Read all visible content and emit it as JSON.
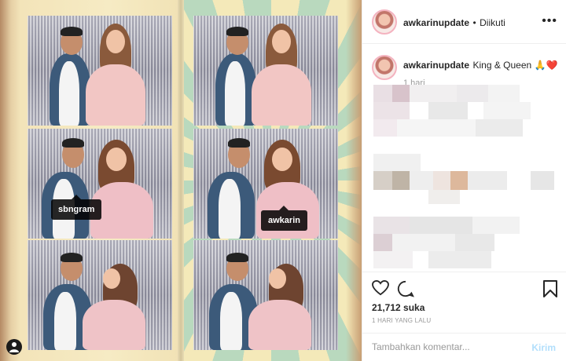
{
  "photo": {
    "tags": [
      "sbngram",
      "awkarin"
    ]
  },
  "header": {
    "username": "awkarinupdate",
    "separator": "•",
    "follow_status": "Diikuti",
    "more_icon": "•••"
  },
  "caption": {
    "username": "awkarinupdate",
    "text": "King & Queen 🙏❤️",
    "age": "1 hari"
  },
  "actions": {
    "likes": "21,712 suka",
    "posted": "1 HARI YANG LALU"
  },
  "comment": {
    "placeholder": "Tambahkan komentar...",
    "send_label": "Kirim"
  },
  "colors": {
    "accent": "#b2dffc",
    "text": "#262626",
    "muted": "#999999",
    "border": "#efefef"
  }
}
